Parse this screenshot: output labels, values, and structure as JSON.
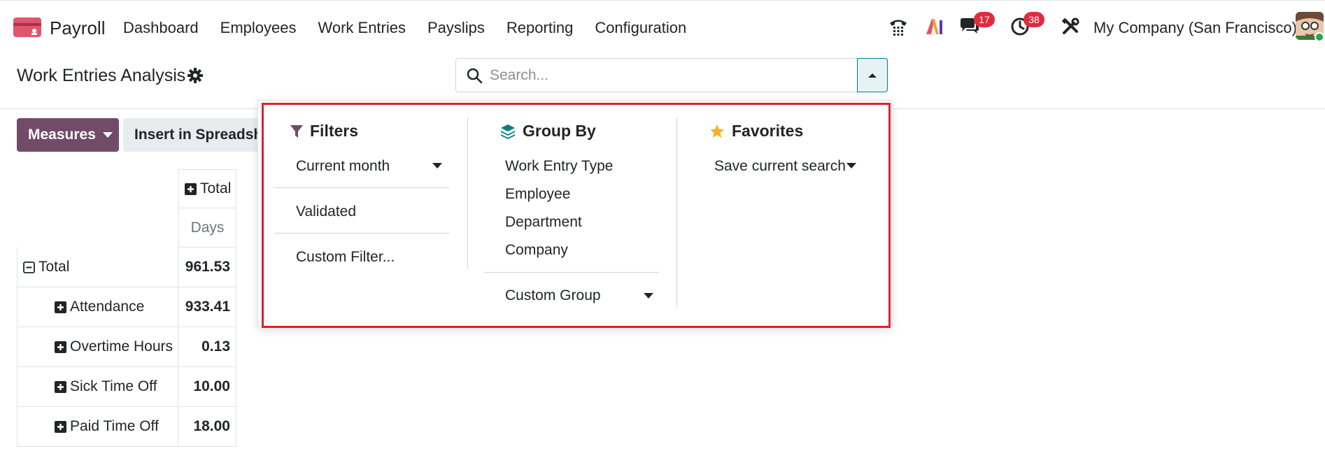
{
  "navbar": {
    "app_name": "Payroll",
    "menu": [
      "Dashboard",
      "Employees",
      "Work Entries",
      "Payslips",
      "Reporting",
      "Configuration"
    ],
    "messages_badge": "17",
    "activities_badge": "38",
    "company": "My Company (San Francisco)"
  },
  "control_panel": {
    "title": "Work Entries Analysis",
    "search_placeholder": "Search...",
    "measures_label": "Measures",
    "spreadsheet_label": "Insert in Spreadsheet"
  },
  "pivot": {
    "col_header": "Total",
    "measure": "Days",
    "rows": [
      {
        "label": "Total",
        "value": "961.53"
      },
      {
        "label": "Attendance",
        "value": "933.41"
      },
      {
        "label": "Overtime Hours",
        "value": "0.13"
      },
      {
        "label": "Sick Time Off",
        "value": "10.00"
      },
      {
        "label": "Paid Time Off",
        "value": "18.00"
      }
    ]
  },
  "dropdown": {
    "filters": {
      "title": "Filters",
      "items": [
        "Current month",
        "Validated",
        "Custom Filter..."
      ]
    },
    "group_by": {
      "title": "Group By",
      "items": [
        "Work Entry Type",
        "Employee",
        "Department",
        "Company",
        "Custom Group"
      ]
    },
    "favorites": {
      "title": "Favorites",
      "items": [
        "Save current search"
      ]
    }
  },
  "colors": {
    "brand": "#714b67",
    "accent": "#017e84",
    "badge": "#e02c3f",
    "highlight": "#e0202e"
  }
}
